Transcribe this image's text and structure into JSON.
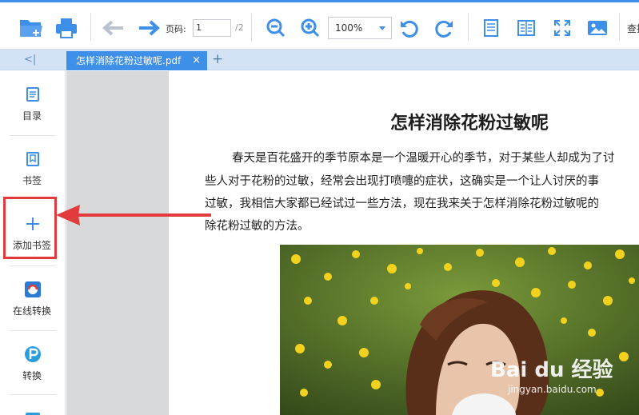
{
  "toolbar": {
    "page_label": "页码:",
    "page_value": "1",
    "page_total": "/2",
    "zoom": "100%",
    "search_label": "查找"
  },
  "tabs": {
    "collapse": "<|",
    "active_tab": "怎样消除花粉过敏呢.pdf",
    "close": "×",
    "add": "+"
  },
  "sidebar": {
    "items": [
      {
        "label": "目录",
        "icon": "toc-icon"
      },
      {
        "label": "书签",
        "icon": "bookmark-icon"
      },
      {
        "label": "添加书签",
        "icon": "add-bookmark-icon"
      },
      {
        "label": "在线转换",
        "icon": "online-convert-icon"
      },
      {
        "label": "转换",
        "icon": "convert-icon"
      }
    ]
  },
  "document": {
    "title": "怎样消除花粉过敏呢",
    "lines": [
      "春天是百花盛开的季节原本是一个温暖开心的季节，对于某些人却成为了讨",
      "些人对于花粉的过敏，经常会出现打喷嚏的症状，这确实是一个让人讨厌的事",
      "过敏，我相信大家都已经试过一些方法，现在我来关于怎样消除花粉过敏呢的",
      "除花粉过敏的方法。"
    ]
  },
  "watermark": {
    "main": "Bai du 经验",
    "sub": "jingyan.baidu.com"
  },
  "colors": {
    "accent": "#3d8fe8",
    "highlight": "#e23b3b"
  }
}
